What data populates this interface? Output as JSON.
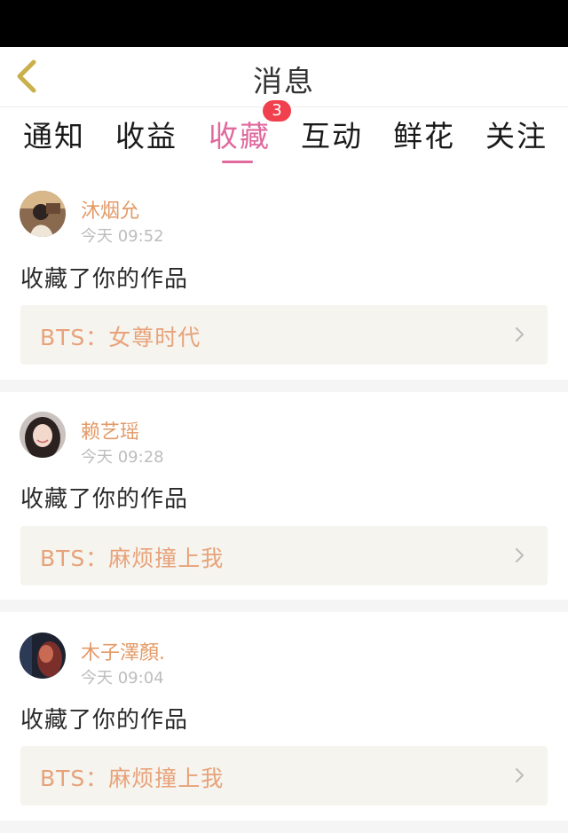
{
  "header": {
    "title": "消息"
  },
  "tabs": [
    {
      "label": "通知"
    },
    {
      "label": "收益"
    },
    {
      "label": "收藏",
      "active": true,
      "badge": "3"
    },
    {
      "label": "互动"
    },
    {
      "label": "鲜花"
    },
    {
      "label": "关注"
    }
  ],
  "messages": [
    {
      "user": "沐烟允",
      "time": "今天 09:52",
      "action": "收藏了你的作品",
      "work": "BTS：女尊时代"
    },
    {
      "user": "赖艺瑶",
      "time": "今天 09:28",
      "action": "收藏了你的作品",
      "work": "BTS：麻烦撞上我"
    },
    {
      "user": "木子澤顏.",
      "time": "今天 09:04",
      "action": "收藏了你的作品",
      "work": "BTS：麻烦撞上我"
    }
  ],
  "colors": {
    "accent": "#e0699e",
    "badge": "#f0404e",
    "username": "#e39a67",
    "work_text": "#e8a27a",
    "card_bg": "#f5f4ee"
  },
  "icons": {
    "back": "chevron-left-icon",
    "work_arrow": "chevron-right-icon"
  }
}
